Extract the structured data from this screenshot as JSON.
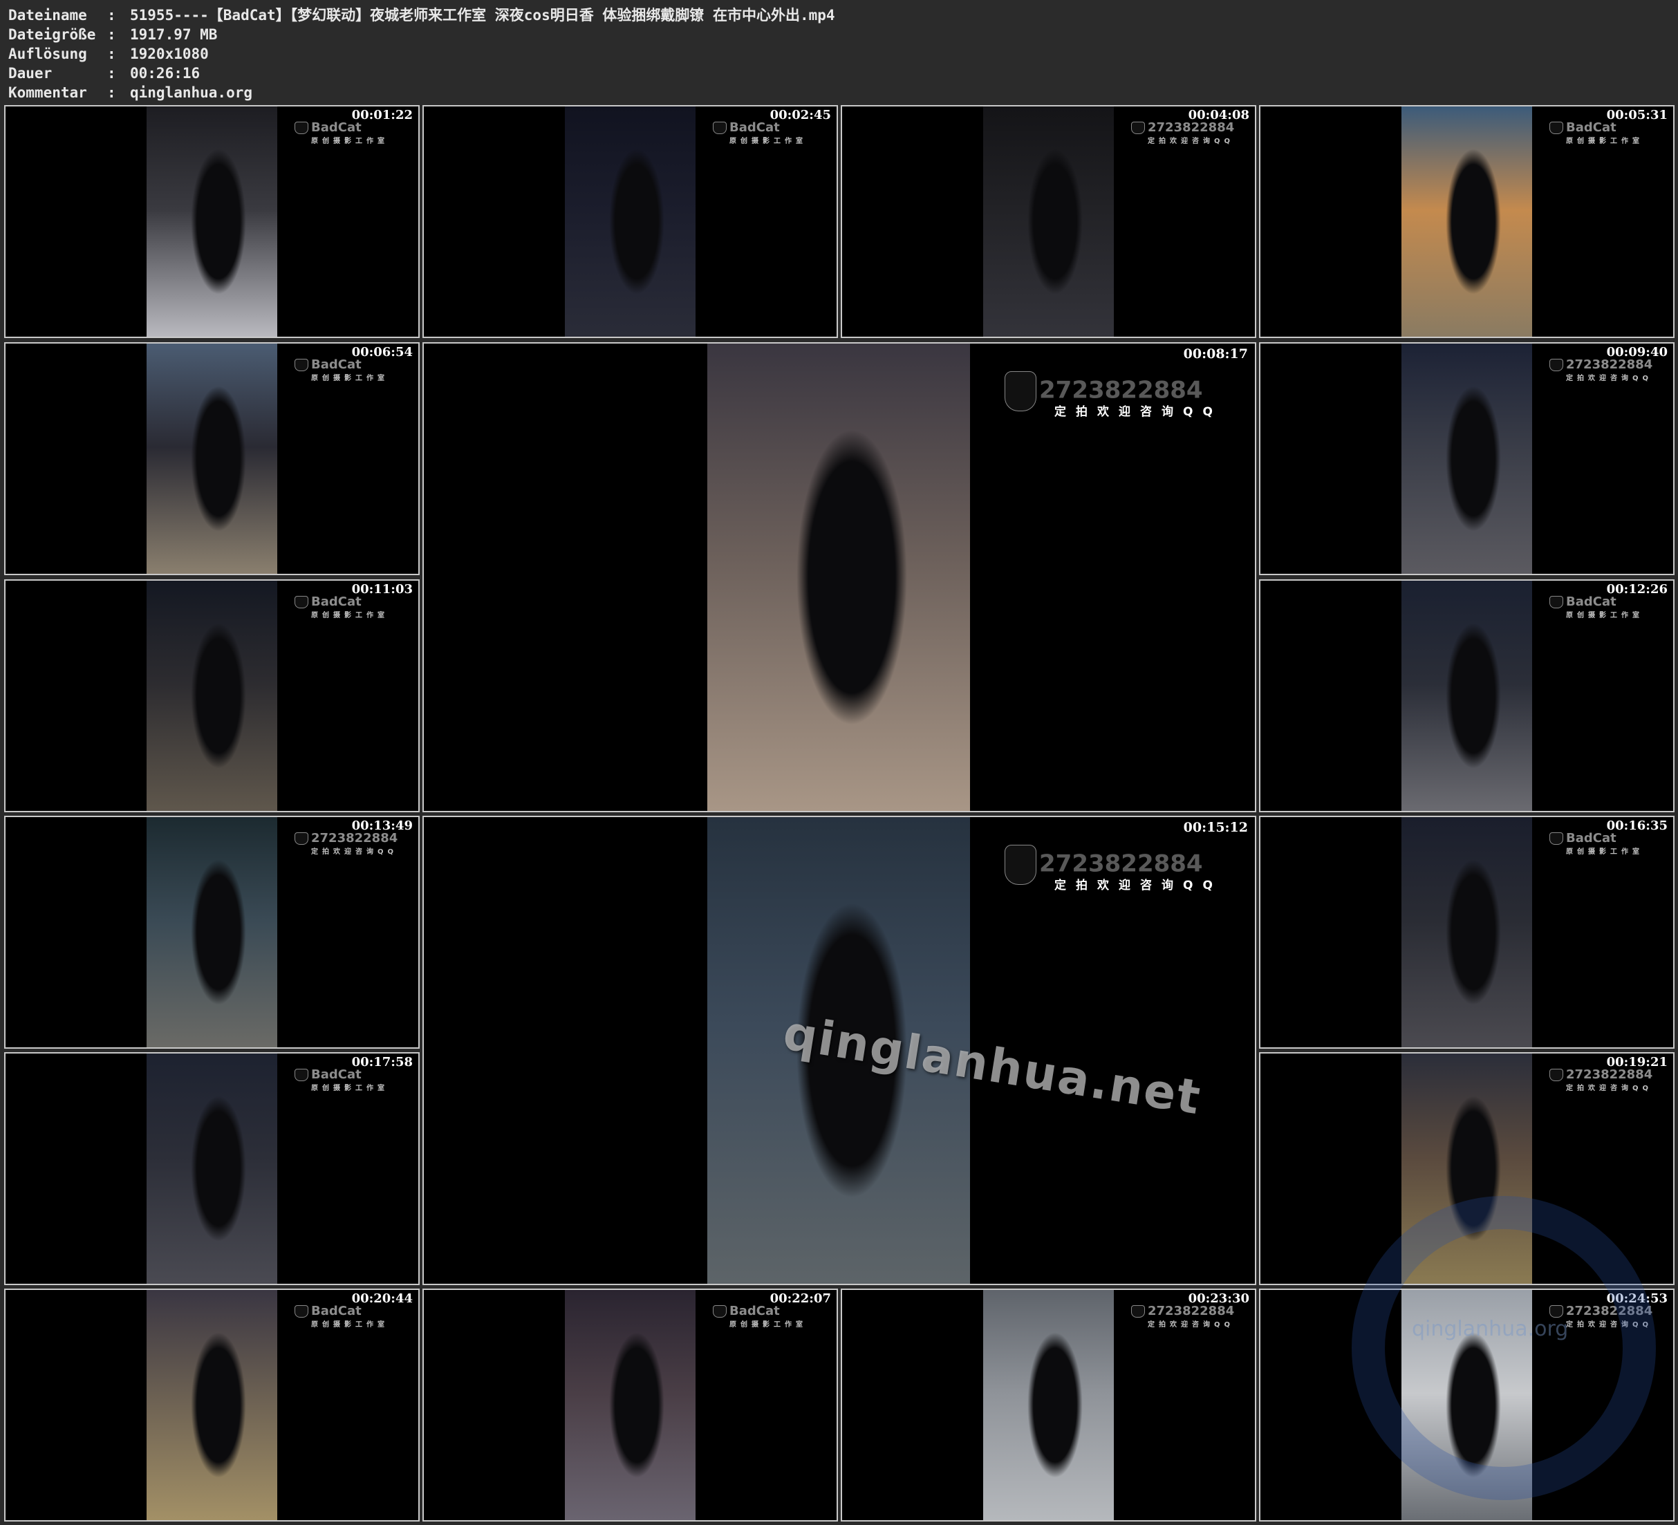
{
  "info": [
    {
      "key": "Dateiname",
      "sep": ":",
      "value": "51955----【BadCat】【梦幻联动】夜城老师来工作室 深夜cos明日香 体验捆绑戴脚镣 在市中心外出.mp4"
    },
    {
      "key": "Dateigröße",
      "sep": ":",
      "value": "1917.97 MB"
    },
    {
      "key": "Auflösung",
      "sep": ":",
      "value": "1920x1080"
    },
    {
      "key": "Dauer",
      "sep": ":",
      "value": "00:26:16"
    },
    {
      "key": "Kommentar",
      "sep": ":",
      "value": "qinglanhua.org"
    }
  ],
  "thumbnails": [
    {
      "time": "00:01:22",
      "wm": "BadCat",
      "wm_sub": "原创摄影工作室"
    },
    {
      "time": "00:02:45",
      "wm": "BadCat",
      "wm_sub": "原创摄影工作室"
    },
    {
      "time": "00:04:08",
      "wm": "2723822884",
      "wm_sub": "定拍欢迎咨询QQ"
    },
    {
      "time": "00:05:31",
      "wm": "BadCat",
      "wm_sub": "原创摄影工作室"
    },
    {
      "time": "00:06:54",
      "wm": "BadCat",
      "wm_sub": "原创摄影工作室"
    },
    {
      "time": "00:08:17",
      "wm": "2723822884",
      "wm_sub": "定拍欢迎咨询QQ"
    },
    {
      "time": "00:09:40",
      "wm": "2723822884",
      "wm_sub": "定拍欢迎咨询QQ"
    },
    {
      "time": "00:11:03",
      "wm": "BadCat",
      "wm_sub": "原创摄影工作室"
    },
    {
      "time": "00:12:26",
      "wm": "BadCat",
      "wm_sub": "原创摄影工作室"
    },
    {
      "time": "00:13:49",
      "wm": "2723822884",
      "wm_sub": "定拍欢迎咨询QQ"
    },
    {
      "time": "00:15:12",
      "wm": "2723822884",
      "wm_sub": "定拍欢迎咨询QQ"
    },
    {
      "time": "00:16:35",
      "wm": "BadCat",
      "wm_sub": "原创摄影工作室"
    },
    {
      "time": "00:17:58",
      "wm": "BadCat",
      "wm_sub": "原创摄影工作室"
    },
    {
      "time": "00:19:21",
      "wm": "2723822884",
      "wm_sub": "定拍欢迎咨询QQ"
    },
    {
      "time": "00:20:44",
      "wm": "BadCat",
      "wm_sub": "原创摄影工作室"
    },
    {
      "time": "00:22:07",
      "wm": "BadCat",
      "wm_sub": "原创摄影工作室"
    },
    {
      "time": "00:23:30",
      "wm": "2723822884",
      "wm_sub": "定拍欢迎咨询QQ"
    },
    {
      "time": "00:24:53",
      "wm": "2723822884",
      "wm_sub": "定拍欢迎咨询QQ"
    }
  ],
  "overlay_watermark": "qinglanhua.net",
  "corner_logo_text": "qinglanhua.org",
  "colors": {
    "background": "#2b2b2b",
    "text": "#e8e8e8",
    "thumb_border": "#c9c9c9"
  }
}
